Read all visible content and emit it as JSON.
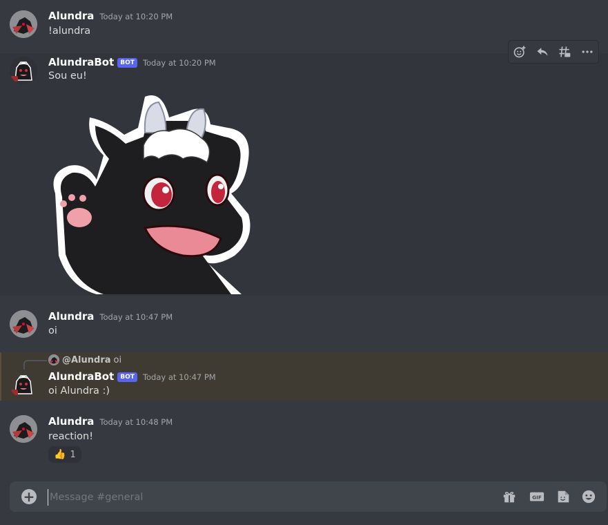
{
  "composer": {
    "placeholder": "Message #general"
  },
  "toolbar": {
    "icons": [
      "add-reaction-icon",
      "reply-icon",
      "create-thread-icon",
      "more-icon"
    ]
  },
  "messages": [
    {
      "author": "Alundra",
      "timestamp": "Today at 10:20 PM",
      "text": "!alundra"
    },
    {
      "author": "AlundraBot",
      "bot_tag": "BOT",
      "timestamp": "Today at 10:20 PM",
      "text": "Sou eu!",
      "sticker": "waving-dragon-sticker"
    },
    {
      "author": "Alundra",
      "timestamp": "Today at 10:47 PM",
      "text": "oi"
    },
    {
      "reply_to": {
        "name": "@Alundra",
        "text": "oi"
      },
      "author": "AlundraBot",
      "bot_tag": "BOT",
      "timestamp": "Today at 10:47 PM",
      "text": "oi Alundra :)"
    },
    {
      "author": "Alundra",
      "timestamp": "Today at 10:48 PM",
      "text": "reaction!",
      "reaction": {
        "emoji": "👍",
        "count": "1"
      }
    }
  ],
  "colors": {
    "background": "#36393f",
    "bot_tag": "#5865f2",
    "mention_highlight": "#3f3b33"
  }
}
